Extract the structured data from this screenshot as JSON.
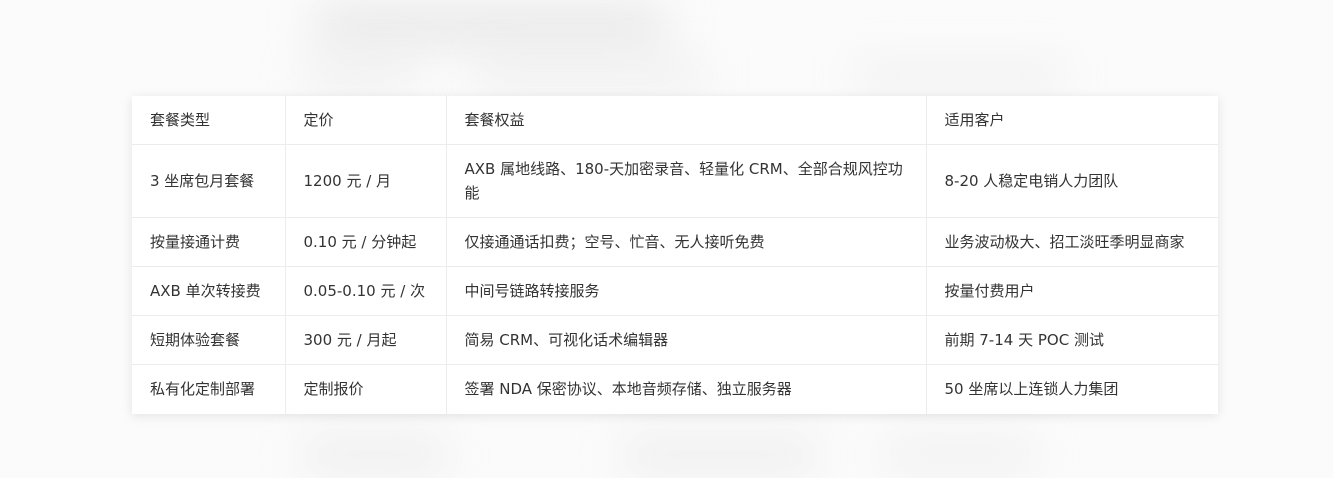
{
  "table": {
    "headers": [
      "套餐类型",
      "定价",
      "套餐权益",
      "适用客户"
    ],
    "rows": [
      [
        "3 坐席包月套餐",
        "1200 元 / 月",
        "AXB 属地线路、180-天加密录音、轻量化 CRM、全部合规风控功能",
        "8-20 人稳定电销人力团队"
      ],
      [
        "按量接通计费",
        "0.10 元 / 分钟起",
        "仅接通通话扣费；空号、忙音、无人接听免费",
        "业务波动极大、招工淡旺季明显商家"
      ],
      [
        "AXB 单次转接费",
        "0.05-0.10 元 / 次",
        "中间号链路转接服务",
        "按量付费用户"
      ],
      [
        "短期体验套餐",
        "300 元 / 月起",
        "简易 CRM、可视化话术编辑器",
        "前期 7-14 天 POC 测试"
      ],
      [
        "私有化定制部署",
        "定制报价",
        "签署 NDA 保密协议、本地音频存储、独立服务器",
        "50 坐席以上连锁人力集团"
      ]
    ]
  }
}
